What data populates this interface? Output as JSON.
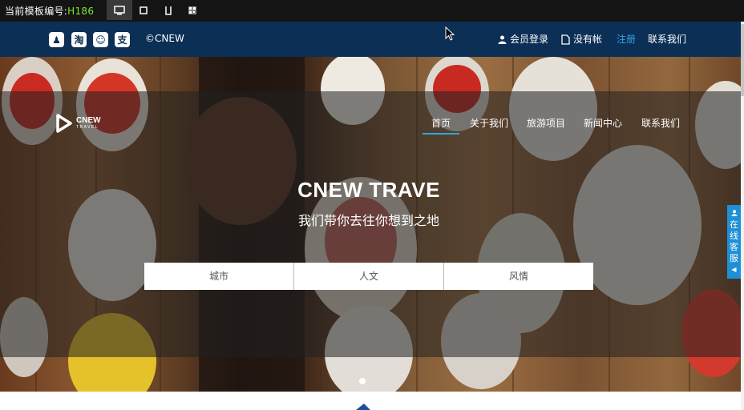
{
  "template_bar": {
    "label": "当前模板编号:",
    "code": "H186",
    "devices": [
      "desktop-icon",
      "tablet-icon",
      "mobile-icon",
      "qrcode-icon"
    ]
  },
  "topbar": {
    "social_icons": [
      {
        "name": "qq-icon",
        "glyph": "♟"
      },
      {
        "name": "taobao-icon",
        "glyph": "淘"
      },
      {
        "name": "weixin-icon",
        "glyph": "☺"
      },
      {
        "name": "alipay-icon",
        "glyph": "支"
      }
    ],
    "copyright": "©CNEW",
    "login": "会员登录",
    "no_account": "没有帐",
    "register": "注册",
    "contact": "联系我们"
  },
  "header": {
    "logo_text": "CNEW",
    "logo_sub": "TRAVEL",
    "nav": [
      "首页",
      "关于我们",
      "旅游项目",
      "新闻中心",
      "联系我们"
    ],
    "active_index": 0
  },
  "hero": {
    "title": "CNEW TRAVE",
    "subtitle": "我们带你去往你想到之地",
    "categories": [
      "城市",
      "人文",
      "风情"
    ],
    "slide_count": 2,
    "active_slide": 0
  },
  "service_tab": {
    "icon": "user-icon",
    "label": "在线客服",
    "arrow": "◀"
  },
  "colors": {
    "topbar_bg": "#0b2f55",
    "accent": "#35a4e0",
    "template_code": "#7dea2e",
    "service_bg": "#1f8fd6"
  }
}
